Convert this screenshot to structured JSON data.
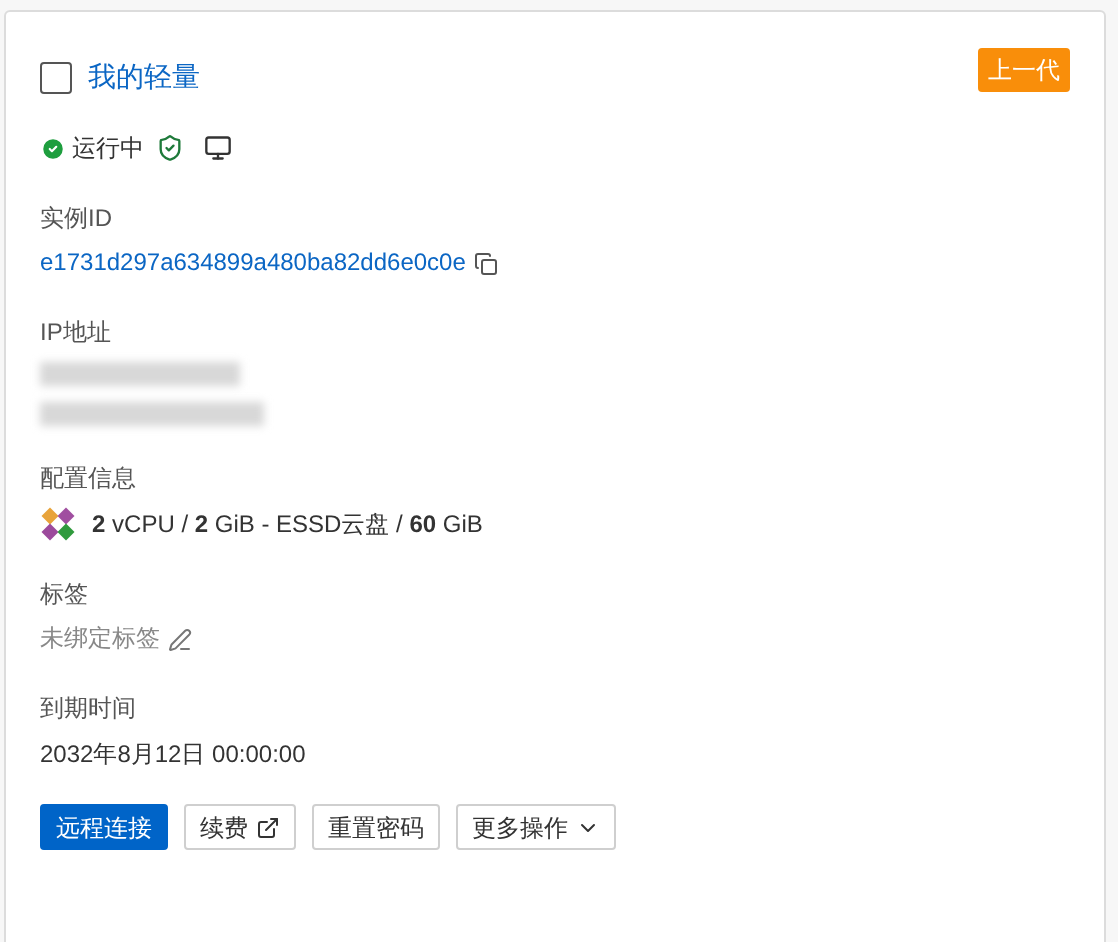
{
  "card": {
    "title": "我的轻量",
    "checked": false,
    "badge": "上一代",
    "status": {
      "label": "运行中",
      "running": true
    },
    "fields": [
      {
        "kind": "id",
        "label": "实例ID",
        "value": "e1731d297a634899a480ba82dd6e0c0e"
      },
      {
        "kind": "redacted",
        "label": "IP地址"
      },
      {
        "kind": "spec",
        "label": "配置信息",
        "value": "**2** vCPU / **2** GiB - ESSD云盘 / **60** GiB"
      },
      {
        "kind": "tag",
        "label": "标签",
        "value": "未绑定标签"
      },
      {
        "kind": "text",
        "label": "到期时间",
        "value": "2032年8月12日 00:00:00"
      }
    ],
    "buttons": [
      {
        "label": "远程连接",
        "kind": "primary"
      },
      {
        "label": "续费",
        "kind": "external"
      },
      {
        "label": "重置密码",
        "kind": "plain"
      },
      {
        "label": "更多操作",
        "kind": "menu"
      }
    ]
  }
}
